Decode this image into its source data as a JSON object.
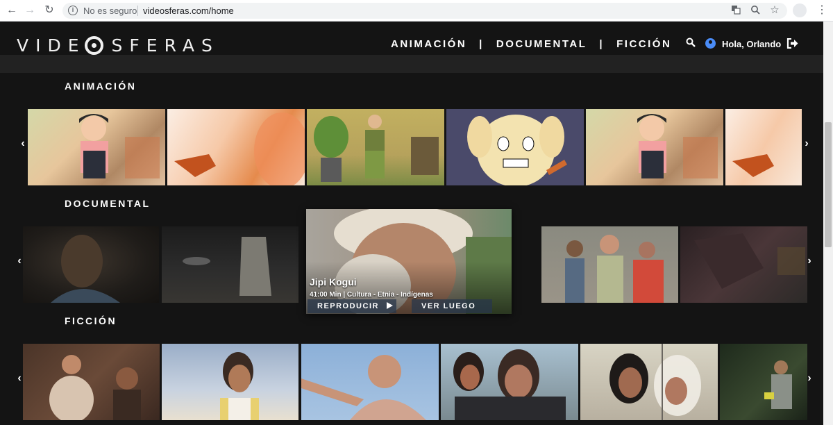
{
  "browser": {
    "security_label": "No es seguro",
    "url": "videosferas.com/home"
  },
  "site": {
    "logo_left": "VIDE",
    "logo_right": "SFERAS",
    "nav": [
      "ANIMACIÓN",
      "DOCUMENTAL",
      "FICCIÓN"
    ],
    "nav_separator": "|",
    "greeting": "Hola, Orlando"
  },
  "sections": {
    "animacion": {
      "title": "ANIMACIÓN"
    },
    "documental": {
      "title": "DOCUMENTAL"
    },
    "ficcion": {
      "title": "FICCIÓN"
    }
  },
  "featured": {
    "title": "Jipi Kogui",
    "meta": "41:00 Min | Cultura - Etnia - Indígenas",
    "play_label": "REPRODUCIR",
    "later_label": "VER LUEGO"
  },
  "icons": {
    "back": "arrow-left-icon",
    "forward": "arrow-right-icon",
    "reload": "reload-icon",
    "info": "info-icon",
    "translate": "translate-icon",
    "zoom": "zoom-icon",
    "bookmark": "star-icon",
    "search": "search-icon",
    "user": "user-icon",
    "logout": "logout-icon",
    "play": "play-icon",
    "add_list": "playlist-add-icon",
    "carousel_prev": "chevron-left-icon",
    "carousel_next": "chevron-right-icon"
  },
  "colors": {
    "background": "#141414",
    "header_band": "#222222",
    "user_icon": "#4a8cf7",
    "text": "#ffffff"
  }
}
